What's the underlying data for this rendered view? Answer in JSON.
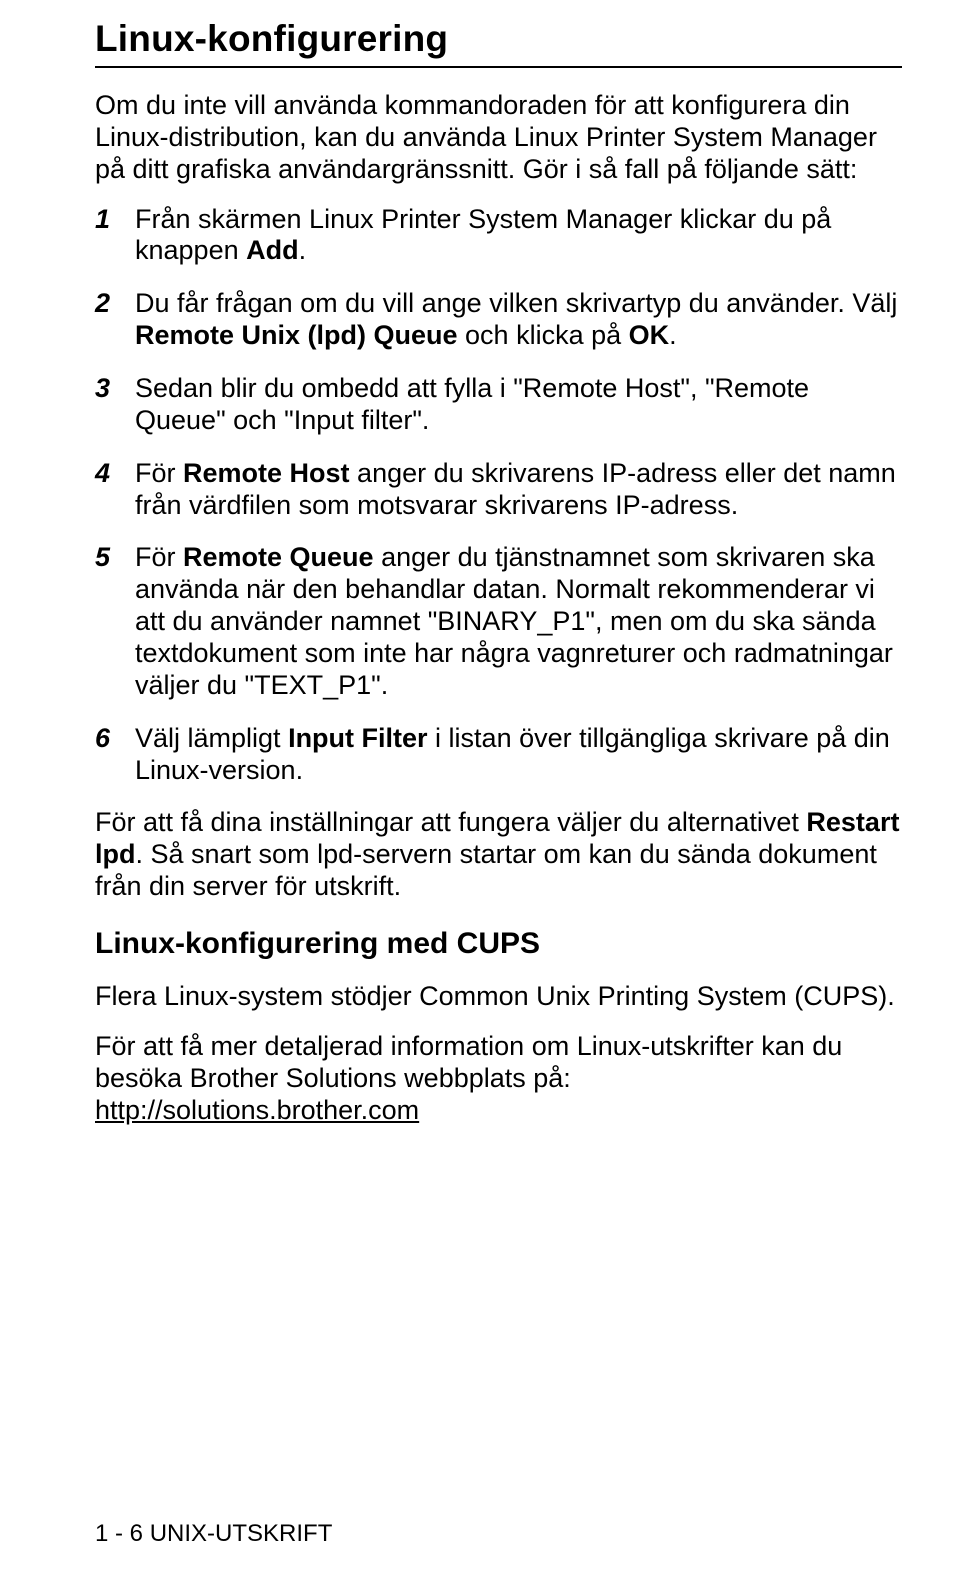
{
  "title": "Linux-konfigurering",
  "intro": "Om du inte vill använda kommandoraden för att konfigurera din Linux-distribution, kan du använda Linux Printer System Manager på ditt grafiska användargränssnitt. Gör i så fall på följande sätt:",
  "steps": {
    "s1_a": "Från skärmen Linux Printer System Manager klickar du på knappen ",
    "s1_b": "Add",
    "s1_c": ".",
    "s2_a": "Du får frågan om du vill ange vilken skrivartyp du använder. Välj ",
    "s2_b": "Remote Unix (lpd) Queue",
    "s2_c": " och klicka på ",
    "s2_d": "OK",
    "s2_e": ".",
    "s3": "Sedan blir du ombedd att fylla i \"Remote Host\", \"Remote Queue\" och \"Input filter\".",
    "s4_a": "För ",
    "s4_b": "Remote Host",
    "s4_c": " anger du skrivarens IP-adress eller det namn från värdfilen som motsvarar skrivarens IP-adress.",
    "s5_a": "För ",
    "s5_b": "Remote Queue",
    "s5_c": " anger du tjänstnamnet som skrivaren ska använda när den behandlar datan. Normalt rekommenderar vi att du använder namnet \"BINARY_P1\", men om du ska sända textdokument som inte har några vagnreturer och radmatningar väljer du \"TEXT_P1\".",
    "s6_a": "Välj lämpligt ",
    "s6_b": "Input Filter",
    "s6_c": " i listan över tillgängliga skrivare på din Linux-version."
  },
  "after_a": "För att få dina inställningar att fungera väljer du alternativet ",
  "after_b": "Restart lpd",
  "after_c": ". Så snart som lpd-servern startar om kan du sända dokument från din server för utskrift.",
  "subheading": "Linux-konfigurering med CUPS",
  "cups_para": "Flera Linux-system stödjer Common Unix Printing System (CUPS).",
  "link_intro": "För att få mer detaljerad information om Linux-utskrifter kan du besöka Brother Solutions webbplats på: ",
  "link_text": "http://solutions.brother.com",
  "footer": "1 - 6 UNIX-UTSKRIFT",
  "nums": {
    "n1": "1",
    "n2": "2",
    "n3": "3",
    "n4": "4",
    "n5": "5",
    "n6": "6"
  }
}
